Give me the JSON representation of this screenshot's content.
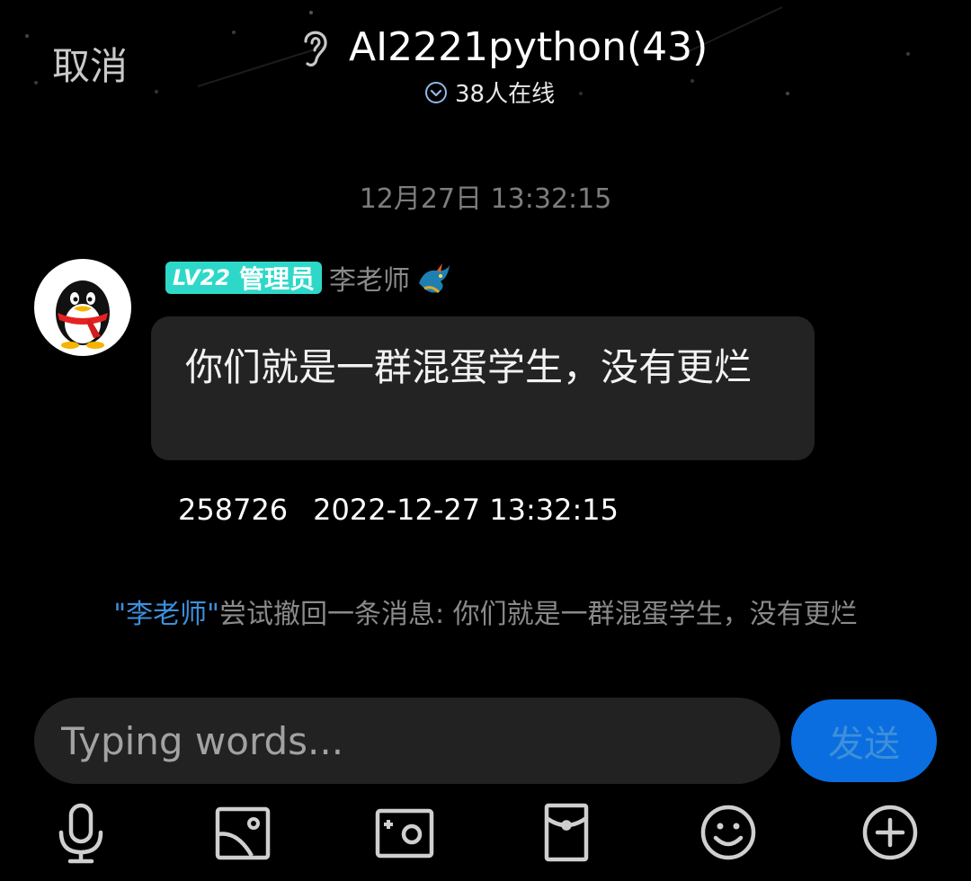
{
  "header": {
    "cancel_label": "取消",
    "title": "AI2221python(43)",
    "online_text": "38人在线"
  },
  "chat": {
    "timestamp": "12月27日 13:32:15",
    "message": {
      "level_label": "LV22",
      "role_label": "管理员",
      "sender_name": "李老师",
      "text": "你们就是一群混蛋学生，没有更烂",
      "meta_id": "258726",
      "meta_datetime": "2022-12-27 13:32:15"
    },
    "recall_notice": {
      "quote_open": "\"",
      "name": "李老师",
      "quote_close": "\"",
      "text": "尝试撤回一条消息: 你们就是一群混蛋学生，没有更烂"
    }
  },
  "composer": {
    "placeholder": "Typing words...",
    "send_label": "发送"
  },
  "toolbar": {
    "icons": [
      "microphone-icon",
      "image-icon",
      "camera-icon",
      "red-packet-icon",
      "emoji-icon",
      "plus-icon"
    ]
  },
  "colors": {
    "background": "#000000",
    "bubble": "#232323",
    "badge": "#2ed8c9",
    "accent_blue": "#0a6ee0",
    "link_blue": "#3d8fdc"
  }
}
